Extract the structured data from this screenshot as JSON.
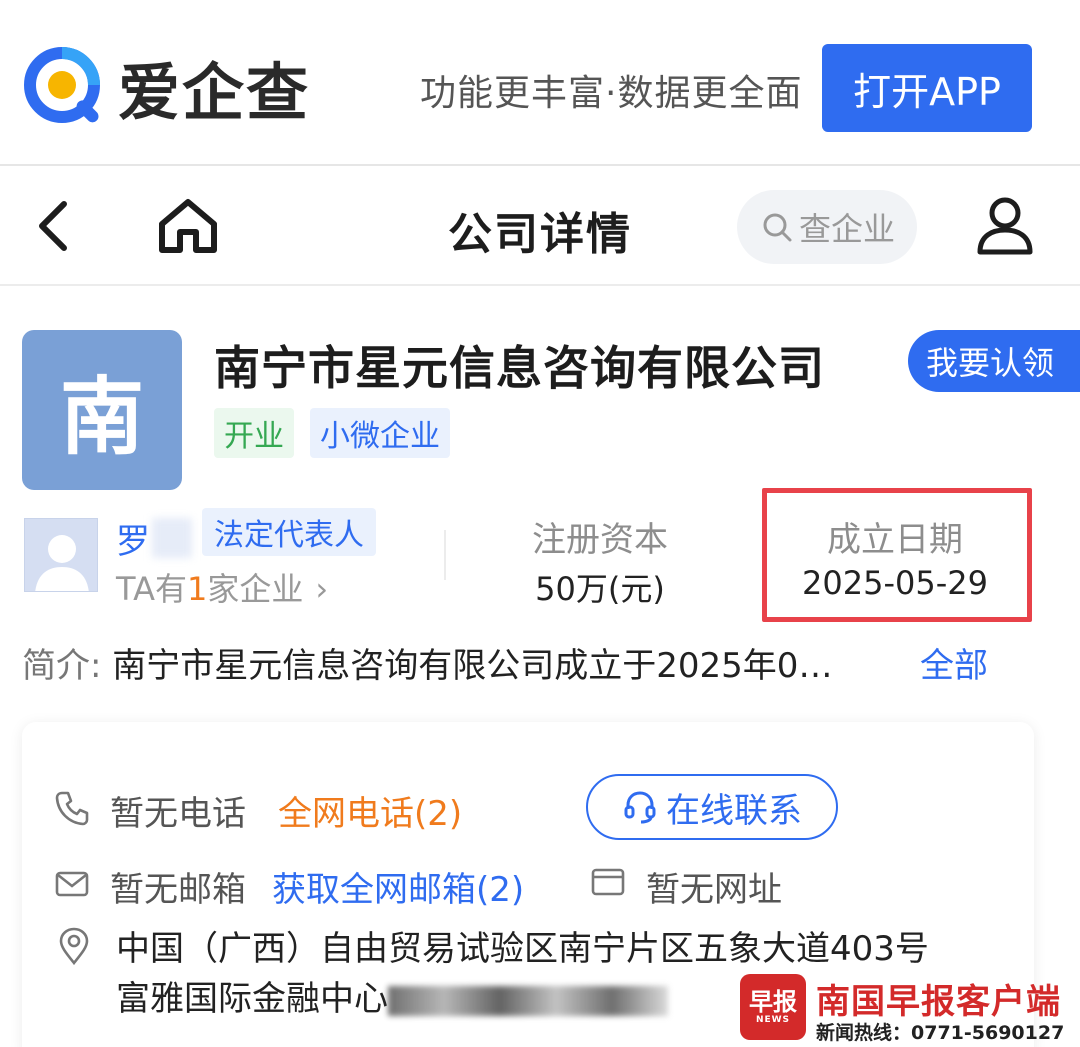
{
  "banner": {
    "logo_text": "爱企查",
    "slogan": "功能更丰富·数据更全面",
    "open_app_label": "打开APP"
  },
  "nav": {
    "title": "公司详情",
    "search_placeholder": "查企业"
  },
  "company": {
    "avatar_char": "南",
    "name": "南宁市星元信息咨询有限公司",
    "tags": [
      "开业",
      "小微企业"
    ],
    "claim_label": "我要认领"
  },
  "legal_rep": {
    "name_visible": "罗",
    "role_tag": "法定代表人",
    "companies_prefix": "TA有",
    "companies_count": "1",
    "companies_suffix": "家企业"
  },
  "stats": {
    "capital_label": "注册资本",
    "capital_value": "50万(元)",
    "founded_label": "成立日期",
    "founded_value": "2025-05-29"
  },
  "intro": {
    "label": "简介:",
    "text": "南宁市星元信息咨询有限公司成立于2025年0…",
    "more_label": "全部"
  },
  "contact": {
    "phone_status": "暂无电话",
    "phone_link": "全网电话(2)",
    "online_label": "在线联系",
    "email_status": "暂无邮箱",
    "email_link": "获取全网邮箱(2)",
    "website_status": "暂无网址",
    "address_line1": "中国（广西）自由贸易试验区南宁片区五象大道403号",
    "address_line2_prefix": "富雅国际金融中心"
  },
  "watermark": {
    "badge_text": "早报",
    "badge_sub": "NEWS",
    "title": "南国早报客户端",
    "hotline": "新闻热线：0771-5690127"
  },
  "colors": {
    "brand_blue": "#2f6cf0",
    "highlight_red": "#e8424a",
    "accent_orange": "#f07b1d",
    "tag_green": "#35a852"
  }
}
